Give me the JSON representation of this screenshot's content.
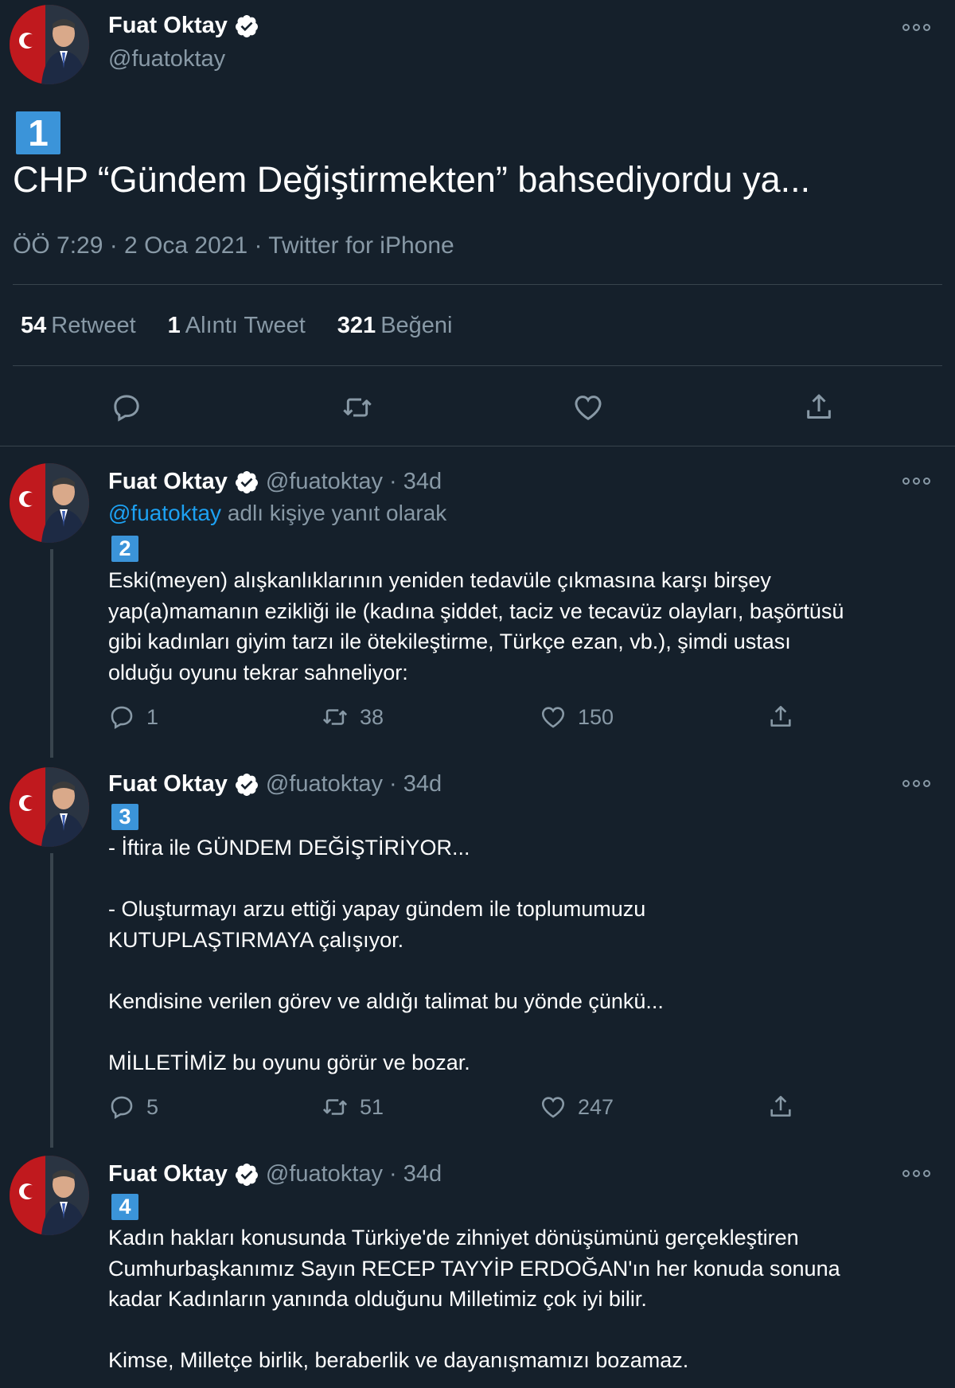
{
  "colors": {
    "background": "#15202b",
    "text": "#ffffff",
    "muted": "#8899a6",
    "link": "#1da1f2",
    "badge": "#3b94d9",
    "divider": "#38444d"
  },
  "main_tweet": {
    "name": "Fuat Oktay",
    "handle": "@fuatoktay",
    "badge": "1",
    "text": "CHP “Gündem Değiştirmekten” bahsediyordu ya...",
    "meta": "ÖÖ 7:29 · 2 Oca 2021 · Twitter for iPhone",
    "stats": {
      "retweets": "54",
      "retweets_label": "Retweet",
      "quotes": "1",
      "quotes_label": "Alıntı Tweet",
      "likes": "321",
      "likes_label": "Beğeni"
    },
    "icons": [
      "reply-icon",
      "retweet-icon",
      "like-icon",
      "share-icon"
    ]
  },
  "replies": [
    {
      "name": "Fuat Oktay",
      "handle": "@fuatoktay",
      "age": "· 34d",
      "replying_mention": "@fuatoktay",
      "replying_text": " adlı kişiye yanıt olarak",
      "badge": "2",
      "text": "Eski(meyen) alışkanlıklarının yeniden tedavüle çıkmasına karşı birşey\nyap(a)mamanın ezikliği ile (kadına şiddet, taciz ve tecavüz olayları, başörtüsü\ngibi kadınları giyim tarzı ile ötekileştirme, Türkçe ezan, vb.), şimdi ustası\nolduğu oyunu tekrar sahneliyor:",
      "replies": "1",
      "retweets": "38",
      "likes": "150"
    },
    {
      "name": "Fuat Oktay",
      "handle": "@fuatoktay",
      "age": "· 34d",
      "badge": "3",
      "text": "- İftira ile GÜNDEM DEĞİŞTİRİYOR...\n\n- Oluşturmayı arzu ettiği yapay gündem ile toplumumuzu\nKUTUPLAŞTIRMAYA çalışıyor.\n\nKendisine verilen görev ve aldığı talimat bu yönde çünkü...\n\nMİLLETİMİZ bu oyunu görür ve bozar.",
      "replies": "5",
      "retweets": "51",
      "likes": "247"
    },
    {
      "name": "Fuat Oktay",
      "handle": "@fuatoktay",
      "age": "· 34d",
      "badge": "4",
      "text": "Kadın hakları konusunda Türkiye'de zihniyet dönüşümünü gerçekleştiren\nCumhurbaşkanımız Sayın RECEP TAYYİP ERDOĞAN'ın her konuda sonuna\nkadar Kadınların yanında olduğunu Milletimiz çok iyi bilir.\n\nKimse, Milletçe birlik, beraberlik ve dayanışmamızı bozamaz."
    }
  ]
}
